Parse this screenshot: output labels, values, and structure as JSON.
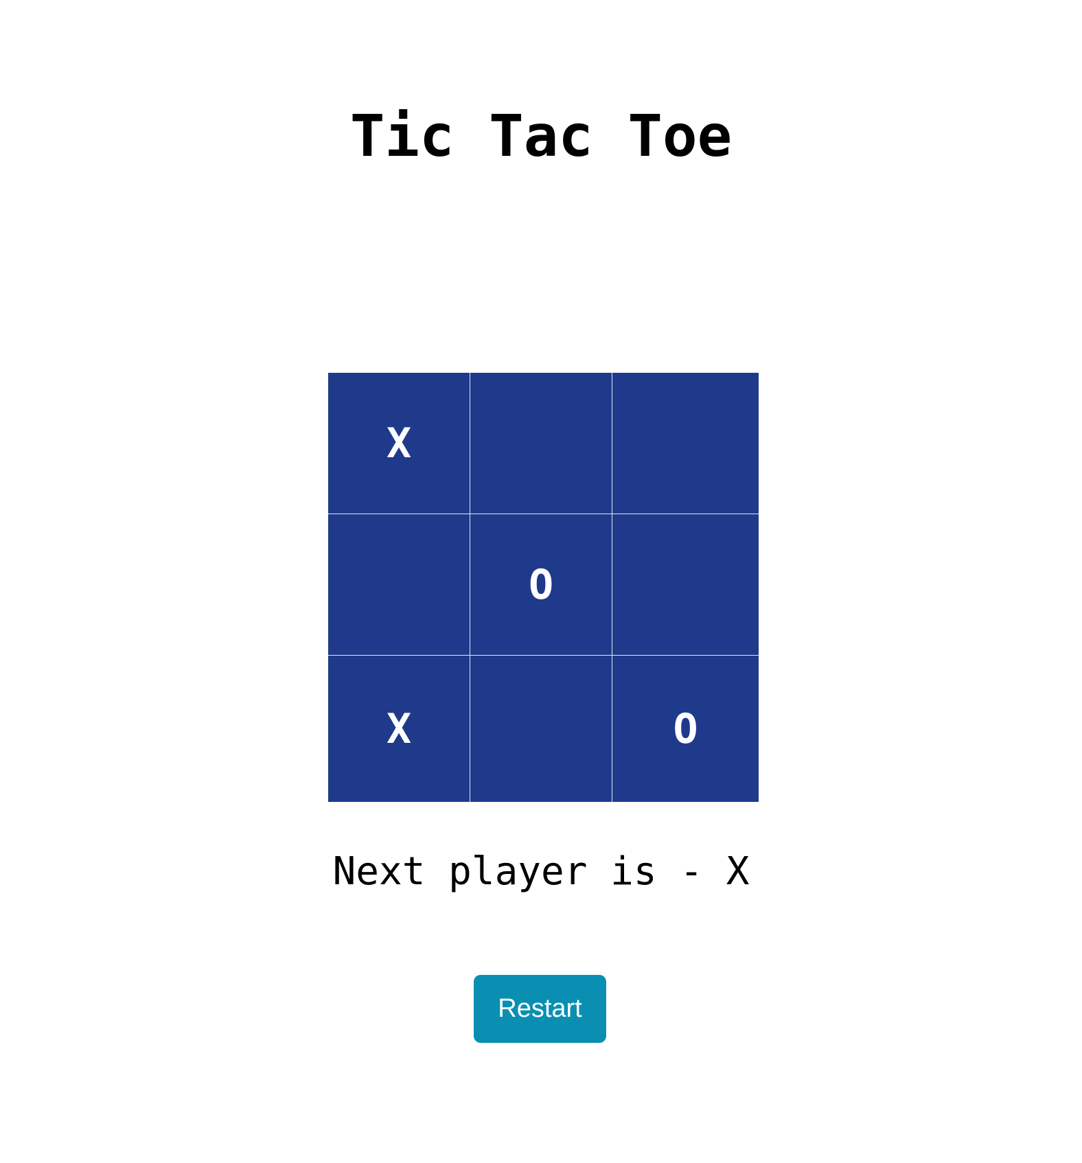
{
  "title": "Tic Tac Toe",
  "board": {
    "cells": [
      "X",
      "",
      "",
      "",
      "O",
      "",
      "X",
      "",
      "O"
    ]
  },
  "status": "Next player is - X",
  "restart_label": "Restart",
  "colors": {
    "cell_background": "#1f3a8a",
    "cell_text": "#ffffff",
    "grid_lines": "#e6e8ef",
    "restart_button": "#0a8fb3",
    "page_background": "#ffffff"
  }
}
